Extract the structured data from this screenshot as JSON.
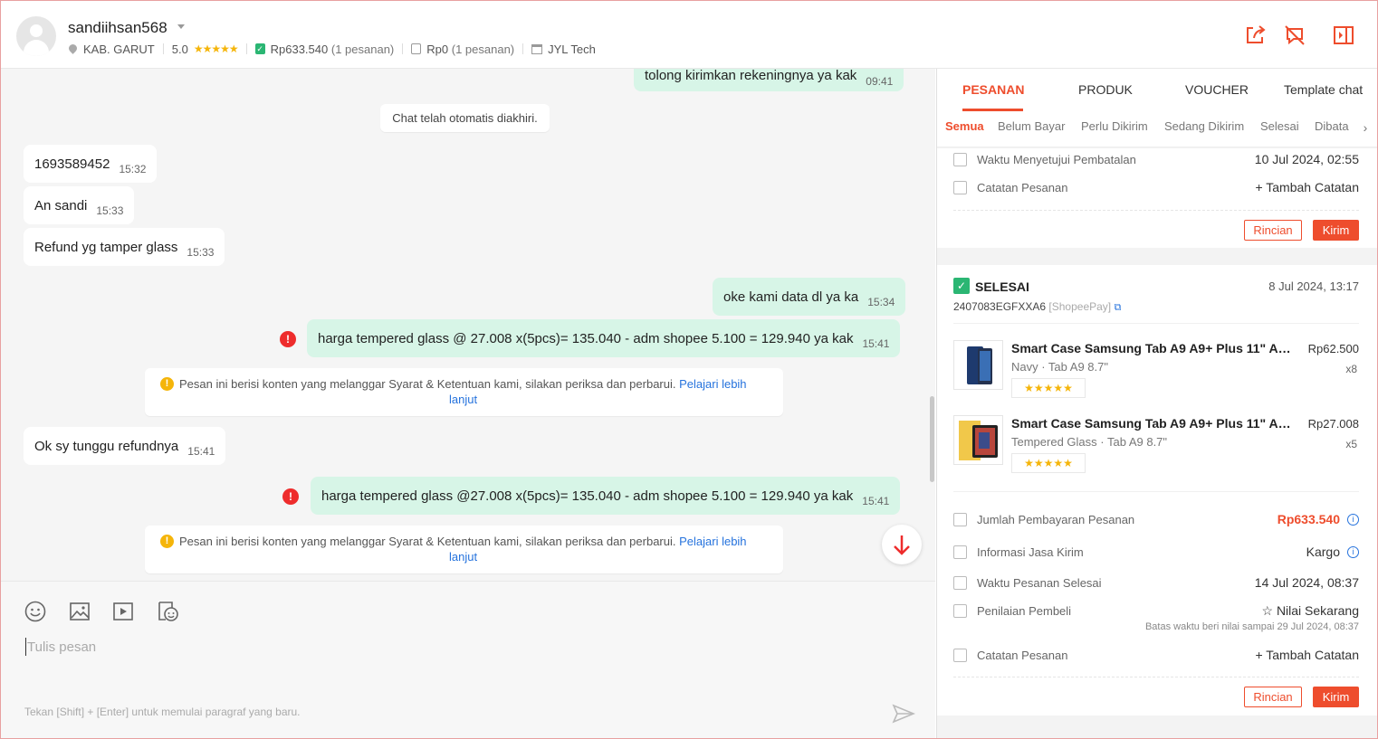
{
  "header": {
    "username": "sandiihsan568",
    "location": "KAB. GARUT",
    "rating": "5.0",
    "stars": "★★★★★",
    "paid_total": "Rp633.540",
    "paid_orders": "(1 pesanan)",
    "unpaid_total": "Rp0",
    "unpaid_orders": "(1 pesanan)",
    "shop": "JYL Tech"
  },
  "chat": {
    "messages": [
      {
        "text": "tolong kirimkan rekeningnya ya kak",
        "time": "09:41"
      },
      {
        "text": "1693589452",
        "time": "15:32"
      },
      {
        "text": "An sandi",
        "time": "15:33"
      },
      {
        "text": "Refund yg tamper glass",
        "time": "15:33"
      },
      {
        "text": "oke kami data dl ya ka",
        "time": "15:34"
      },
      {
        "text": "harga tempered glass @ 27.008 x(5pcs)= 135.040 - adm shopee 5.100 = 129.940 ya kak",
        "time": "15:41"
      },
      {
        "text": "Ok sy tunggu refundnya",
        "time": "15:41"
      },
      {
        "text": "harga tempered glass @27.008 x(5pcs)= 135.040 - adm shopee 5.100 = 129.940 ya kak",
        "time": "15:41"
      }
    ],
    "system_notice": "Chat telah otomatis diakhiri.",
    "warning_text": "Pesan ini berisi konten yang melanggar Syarat & Ketentuan kami, silakan periksa dan perbarui.",
    "warning_link_1": "Pelajari lebih",
    "warning_link_2": "lanjut"
  },
  "composer": {
    "placeholder": "Tulis pesan",
    "hint": "Tekan [Shift] + [Enter] untuk memulai paragraf yang baru."
  },
  "panel": {
    "tabs": [
      "PESANAN",
      "PRODUK",
      "VOUCHER",
      "Template chat"
    ],
    "subtabs": [
      "Semua",
      "Belum Bayar",
      "Perlu Dikirim",
      "Sedang Dikirim",
      "Selesai",
      "Dibata"
    ],
    "order1": {
      "approve_label": "Waktu Menyetujui Pembatalan",
      "approve_value": "10 Jul 2024, 02:55",
      "note_label": "Catatan Pesanan",
      "note_action": "+ Tambah Catatan",
      "btn_detail": "Rincian",
      "btn_send": "Kirim"
    },
    "order2": {
      "status": "SELESAI",
      "date": "8 Jul 2024, 13:17",
      "order_id": "2407083EGFXXA6",
      "source": "[ShopeePay]",
      "products": [
        {
          "name": "Smart Case Samsung Tab A9 A9+ Plus 11\" A8 ...",
          "variant": "Navy · Tab A9 8.7\"",
          "price": "Rp62.500",
          "qty": "x8",
          "stars": "★★★★★"
        },
        {
          "name": "Smart Case Samsung Tab A9 A9+ Plus 11\" A8 ...",
          "variant": "Tempered Glass · Tab A9 8.7\"",
          "price": "Rp27.008",
          "qty": "x5",
          "stars": "★★★★★"
        }
      ],
      "payment_label": "Jumlah Pembayaran Pesanan",
      "payment_value": "Rp633.540",
      "shipping_label": "Informasi Jasa Kirim",
      "shipping_value": "Kargo",
      "completed_label": "Waktu Pesanan Selesai",
      "completed_value": "14 Jul 2024, 08:37",
      "rating_label": "Penilaian Pembeli",
      "rating_action": "Nilai Sekarang",
      "rating_deadline": "Batas waktu beri nilai sampai 29 Jul 2024, 08:37",
      "note_label": "Catatan Pesanan",
      "note_action": "+ Tambah Catatan",
      "btn_detail": "Rincian",
      "btn_send": "Kirim"
    }
  },
  "colors": {
    "accent": "#ee4d2d",
    "outgoing": "#d7f5e7",
    "link": "#2673dd",
    "success": "#2bb673"
  }
}
